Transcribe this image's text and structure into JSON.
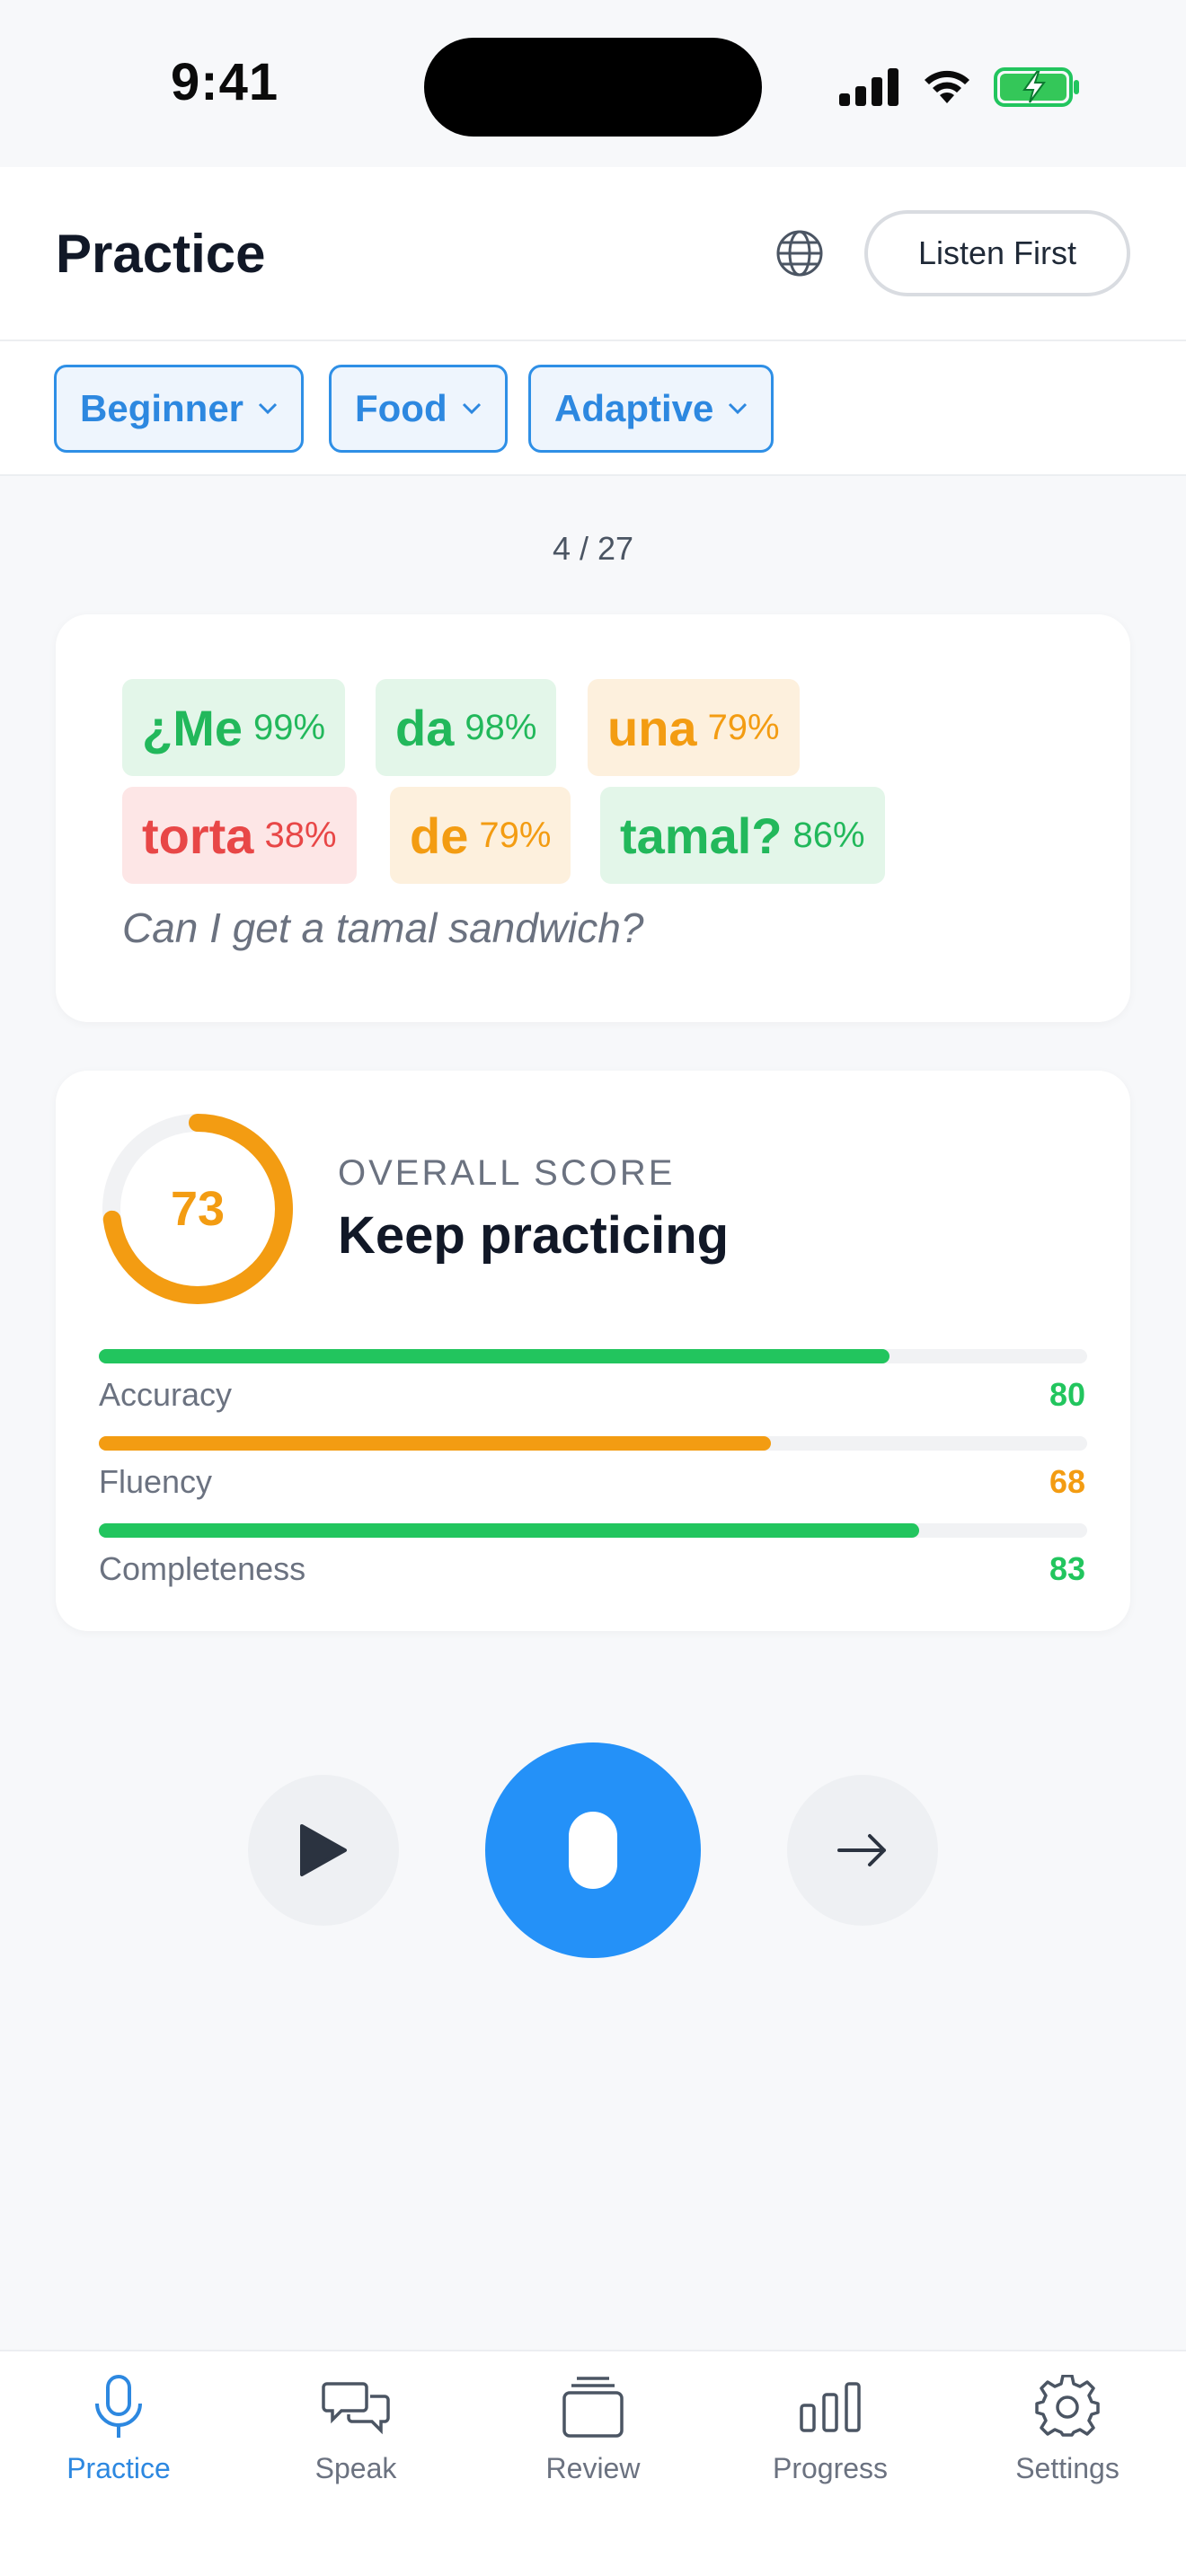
{
  "status_bar": {
    "time": "9:41"
  },
  "header": {
    "title": "Practice",
    "listen_label": "Listen First"
  },
  "filters": [
    {
      "label": "Beginner"
    },
    {
      "label": "Food"
    },
    {
      "label": "Adaptive"
    }
  ],
  "counter": "4 / 27",
  "sentence": {
    "words": [
      {
        "word": "¿Me",
        "score": "99%",
        "level": "good"
      },
      {
        "word": "da",
        "score": "98%",
        "level": "good"
      },
      {
        "word": "una",
        "score": "79%",
        "level": "mid"
      },
      {
        "word": "torta",
        "score": "38%",
        "level": "bad"
      },
      {
        "word": "de",
        "score": "79%",
        "level": "mid"
      },
      {
        "word": "tamal?",
        "score": "86%",
        "level": "good"
      }
    ],
    "translation": "Can I get a tamal sandwich?"
  },
  "score": {
    "overall": "73",
    "overall_value": 73,
    "label": "OVERALL SCORE",
    "verdict": "Keep practicing",
    "metrics": [
      {
        "label": "Accuracy",
        "value": "80",
        "fraction": 0.8,
        "color": "#22c55e"
      },
      {
        "label": "Fluency",
        "value": "68",
        "fraction": 0.68,
        "color": "#f39c12"
      },
      {
        "label": "Completeness",
        "value": "83",
        "fraction": 0.83,
        "color": "#22c55e"
      }
    ]
  },
  "colors": {
    "accent": "#2491f8",
    "good": "#22c55e",
    "mid": "#f39c12",
    "bad": "#e84747"
  },
  "tabs": [
    {
      "label": "Practice",
      "icon": "mic-icon",
      "active": true
    },
    {
      "label": "Speak",
      "icon": "chat-bubbles-icon",
      "active": false
    },
    {
      "label": "Review",
      "icon": "cards-stack-icon",
      "active": false
    },
    {
      "label": "Progress",
      "icon": "bar-chart-icon",
      "active": false
    },
    {
      "label": "Settings",
      "icon": "gear-icon",
      "active": false
    }
  ]
}
